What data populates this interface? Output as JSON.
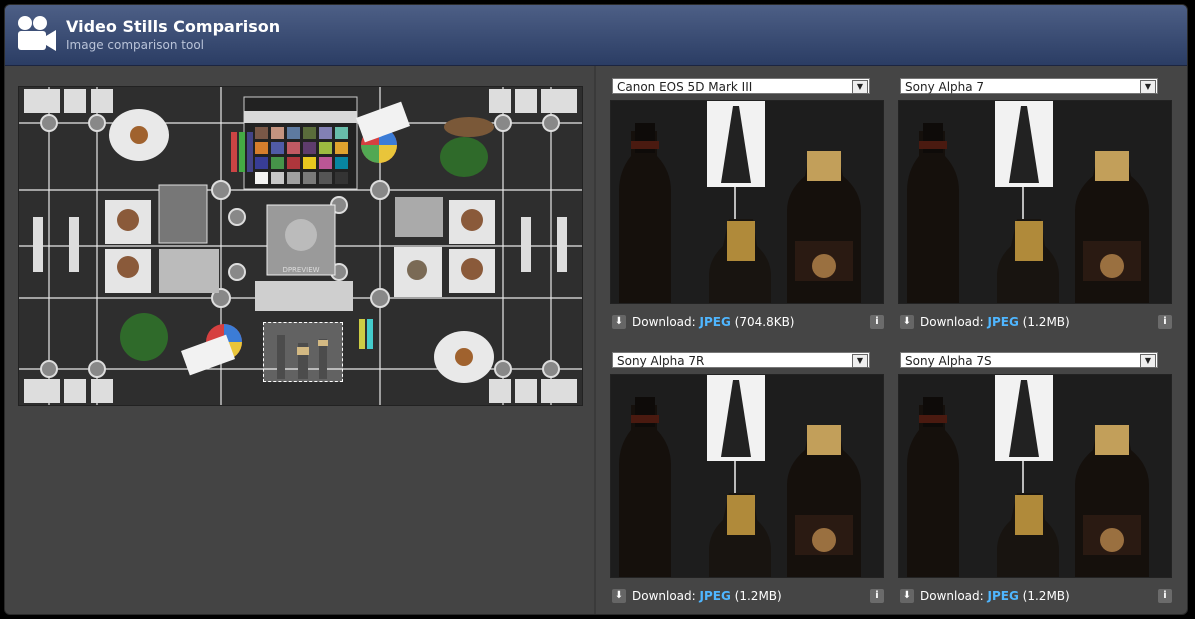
{
  "header": {
    "title": "Video Stills Comparison",
    "subtitle": "Image comparison tool",
    "logo_icon": "video-camera-icon"
  },
  "overview": {
    "chart_label": "DPREVIEW"
  },
  "panels": [
    {
      "camera": "Canon EOS 5D Mark III",
      "download_label": "Download:",
      "format": "JPEG",
      "size": "(704.8KB)"
    },
    {
      "camera": "Sony Alpha 7",
      "download_label": "Download:",
      "format": "JPEG",
      "size": "(1.2MB)"
    },
    {
      "camera": "Sony Alpha 7R",
      "download_label": "Download:",
      "format": "JPEG",
      "size": "(1.2MB)"
    },
    {
      "camera": "Sony Alpha 7S",
      "download_label": "Download:",
      "format": "JPEG",
      "size": "(1.2MB)"
    }
  ],
  "icons": {
    "download": "download-icon",
    "info": "info-icon",
    "dropdown": "chevron-down-icon"
  }
}
